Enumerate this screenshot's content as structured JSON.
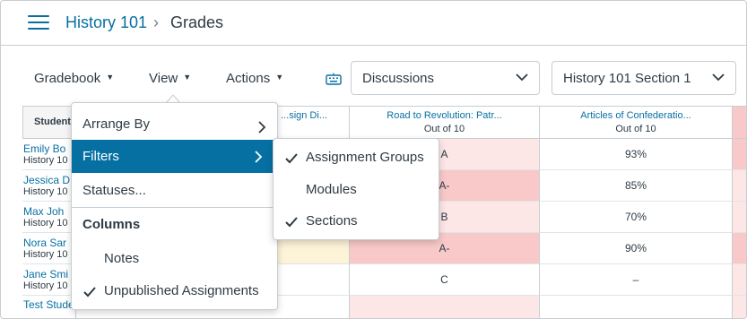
{
  "header": {
    "menu_icon": "hamburger-icon",
    "course": "History 101",
    "separator": "›",
    "current": "Grades"
  },
  "toolbar": {
    "gradebook": "Gradebook",
    "view": "View",
    "actions": "Actions",
    "keyboard_icon": "keyboard-icon",
    "assignment_filter": "Discussions",
    "section_filter": "History 101 Section 1"
  },
  "grid": {
    "student_header": "Student",
    "columns": [
      {
        "title": "...sign Di...",
        "sub": ""
      },
      {
        "title": "Road to Revolution: Patr...",
        "sub": "Out of 10"
      },
      {
        "title": "Articles of Confederatio...",
        "sub": "Out of 10"
      }
    ],
    "rows": [
      {
        "name": "Emily Bo",
        "section": "History 10",
        "grade1": "A",
        "grade2": "93%"
      },
      {
        "name": "Jessica D",
        "section": "History 10",
        "grade1": "A-",
        "grade2": "85%"
      },
      {
        "name": "Max Joh",
        "section": "History 10",
        "grade1": "B",
        "grade2": "70%"
      },
      {
        "name": "Nora Sar",
        "section": "History 10",
        "grade1": "A-",
        "grade2": "90%"
      },
      {
        "name": "Jane Smi",
        "section": "History 10",
        "grade1": "C",
        "grade2": "–"
      },
      {
        "name": "Test Student",
        "section": "",
        "grade1": "",
        "grade2": ""
      }
    ]
  },
  "view_menu": {
    "arrange_by": "Arrange By",
    "filters": "Filters",
    "statuses": "Statuses...",
    "columns_heading": "Columns",
    "notes": "Notes",
    "unpublished": "Unpublished Assignments"
  },
  "filters_submenu": {
    "assignment_groups": "Assignment Groups",
    "modules": "Modules",
    "sections": "Sections"
  },
  "colors": {
    "link": "#0770a3",
    "active_menu": "#0770a3",
    "late_pink": "#fde6e6",
    "missing_pink": "#f9c9c9",
    "excused_yellow": "#fdf3d8",
    "border": "#c7cdd1"
  }
}
